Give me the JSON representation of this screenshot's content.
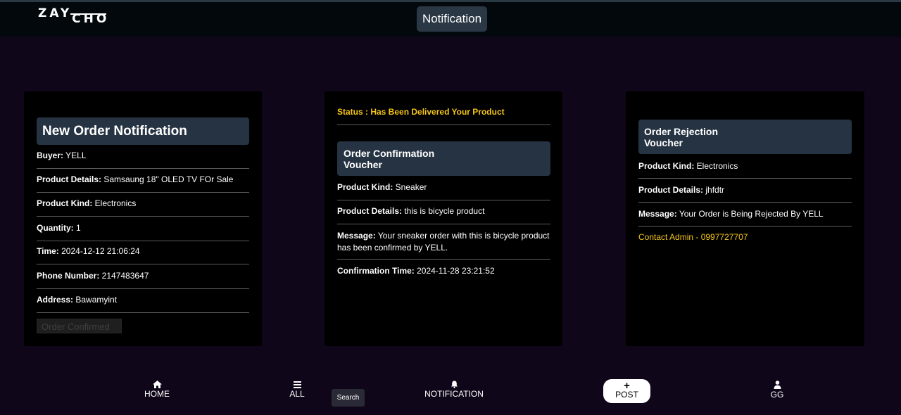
{
  "header": {
    "logo_part1": "ZAY",
    "logo_part2": "CHO",
    "title": "Notification"
  },
  "card_new_order": {
    "heading": "New Order Notification",
    "rows": [
      {
        "label": "Buyer:",
        "value": " YELL"
      },
      {
        "label": "Product Details:",
        "value": " Samsaung 18\" OLED TV FOr Sale"
      },
      {
        "label": "Product Kind:",
        "value": " Electronics"
      },
      {
        "label": "Quantity:",
        "value": " 1"
      },
      {
        "label": "Time:",
        "value": " 2024-12-12 21:06:24"
      },
      {
        "label": "Phone Number:",
        "value": " 2147483647"
      },
      {
        "label": "Address:",
        "value": " Bawamyint"
      }
    ],
    "button_label": "Order Confirmed"
  },
  "card_confirmation": {
    "status": "Status : Has Been Delivered Your Product",
    "heading_line1": "Order Confirmation",
    "heading_line2": "Voucher",
    "rows": [
      {
        "label": "Product Kind:",
        "value": " Sneaker"
      },
      {
        "label": "Product Details:",
        "value": " this is bicycle product"
      },
      {
        "label": "Message:",
        "value": " Your sneaker order with this is bicycle product has been confirmed by YELL."
      },
      {
        "label": "Confirmation Time:",
        "value": " 2024-11-28 23:21:52"
      }
    ]
  },
  "card_rejection": {
    "heading_line1": "Order Rejection",
    "heading_line2": "Voucher",
    "rows": [
      {
        "label": "Product Kind:",
        "value": " Electronics"
      },
      {
        "label": "Product Details:",
        "value": " jhfdtr"
      },
      {
        "label": "Message:",
        "value": " Your Order is Being Rejected By YELL"
      }
    ],
    "contact": "Contact Admin - 0997727707"
  },
  "bottom_nav": {
    "home": "HOME",
    "all": "ALL",
    "search": "Search",
    "notification": "NOTIFICATION",
    "post": "POST",
    "user": "GG"
  },
  "colors": {
    "background": "#0f0619",
    "topbar": "#03080c",
    "card": "#000000",
    "heading_box": "#263343",
    "accent_yellow": "#f5c518"
  },
  "icons": [
    "home-icon",
    "menu-icon",
    "bell-icon",
    "plus-icon",
    "user-icon"
  ]
}
